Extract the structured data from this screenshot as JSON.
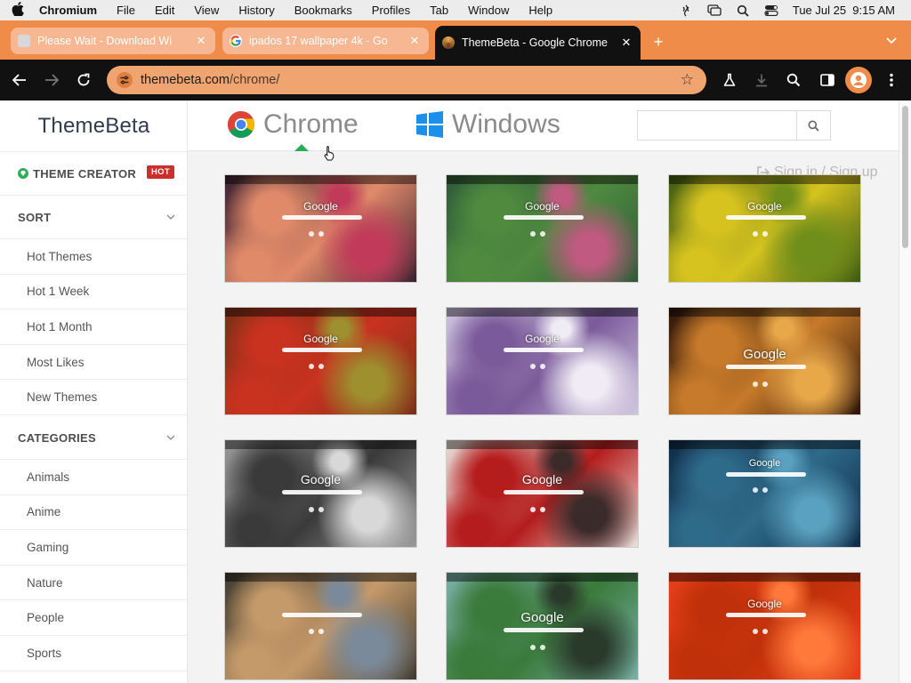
{
  "menubar": {
    "app": "Chromium",
    "items": [
      "File",
      "Edit",
      "View",
      "History",
      "Bookmarks",
      "Profiles",
      "Tab",
      "Window",
      "Help"
    ],
    "clock": "Tue Jul 25  9:15 AM"
  },
  "tabs": [
    {
      "title": "Please Wait - Download Wi",
      "active": false
    },
    {
      "title": "ipados 17 wallpaper 4k - Go",
      "active": false
    },
    {
      "title": "ThemeBeta - Google Chrome",
      "active": true
    }
  ],
  "toolbar": {
    "url_host": "themebeta.com",
    "url_path": "/chrome/"
  },
  "site": {
    "logo": "ThemeBeta",
    "nav": [
      {
        "label": "Chrome",
        "active": true
      },
      {
        "label": "Windows",
        "active": false
      }
    ],
    "search_placeholder": "",
    "signin": "Sign in / Sign up"
  },
  "sidebar": {
    "theme_creator": "THEME CREATOR",
    "hot_badge": "HOT",
    "sort": {
      "heading": "SORT",
      "items": [
        "Hot Themes",
        "Hot 1 Week",
        "Hot 1 Month",
        "Most Likes",
        "New Themes"
      ]
    },
    "categories": {
      "heading": "CATEGORIES",
      "items": [
        "Animals",
        "Anime",
        "Gaming",
        "Nature",
        "People",
        "Sports"
      ]
    }
  },
  "themes": [
    {
      "google_label": "Google",
      "colors": [
        "#3a2030",
        "#e08a6a",
        "#c23a5a"
      ]
    },
    {
      "google_label": "Google",
      "colors": [
        "#2f5a3a",
        "#4f8a3f",
        "#c05a80"
      ]
    },
    {
      "google_label": "Google",
      "colors": [
        "#3b5a12",
        "#d6c31f",
        "#6f8f1a"
      ]
    },
    {
      "google_label": "Google",
      "colors": [
        "#7a3018",
        "#c9321f",
        "#9e8f2f"
      ]
    },
    {
      "google_label": "Google",
      "colors": [
        "#cfc5e0",
        "#7a5a9a",
        "#f0ecf5"
      ]
    },
    {
      "google_label": "Google",
      "colors": [
        "#2a1408",
        "#c77a2a",
        "#e8a84a"
      ]
    },
    {
      "google_label": "Google",
      "colors": [
        "#9a9a9a",
        "#3a3a3a",
        "#d8d8d8"
      ]
    },
    {
      "google_label": "Google",
      "colors": [
        "#e8e0da",
        "#b51c1c",
        "#3a2a2a"
      ]
    },
    {
      "google_label": "Google",
      "colors": [
        "#0f2a45",
        "#2e6a8a",
        "#5aa0c0"
      ]
    },
    {
      "google_label": "",
      "colors": [
        "#3f3a30",
        "#c59a6a",
        "#7a8a9a"
      ]
    },
    {
      "google_label": "Google",
      "colors": [
        "#7ab0a8",
        "#3a7a3a",
        "#2a3a2a"
      ]
    },
    {
      "google_label": "Google",
      "colors": [
        "#e8401a",
        "#c0300a",
        "#ff7a3a"
      ]
    }
  ]
}
